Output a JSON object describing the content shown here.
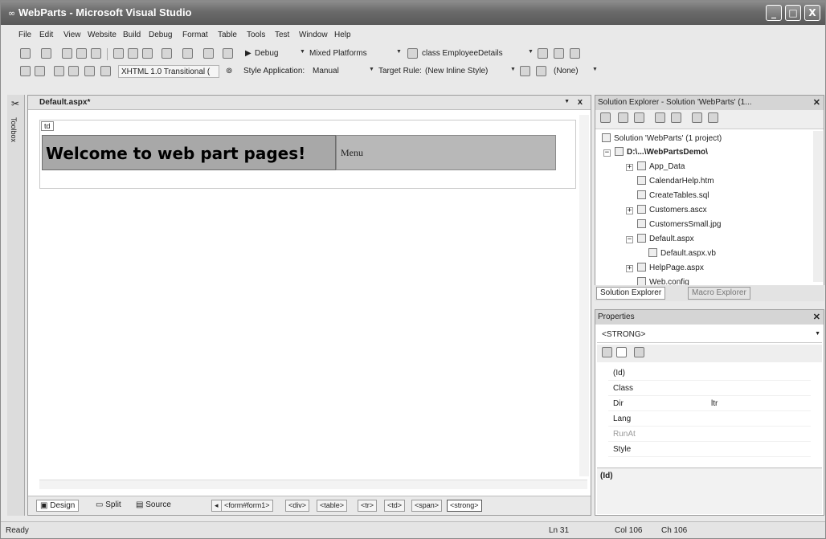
{
  "window": {
    "title": "WebParts - Microsoft Visual Studio",
    "buttons": {
      "minimize": "_",
      "maximize": "□",
      "close": "X"
    }
  },
  "menu": [
    "File",
    "Edit",
    "View",
    "Website",
    "Build",
    "Debug",
    "Format",
    "Table",
    "Tools",
    "Test",
    "Window",
    "Help"
  ],
  "toolbar1": {
    "config": "Debug",
    "platform": "Mixed Platforms",
    "find": "class EmployeeDetails"
  },
  "toolbar2": {
    "doctype": "XHTML 1.0 Transitional (",
    "style_application_label": "Style Application:",
    "style_application_value": "Manual",
    "target_rule_label": "Target Rule:",
    "target_rule_value": "(New Inline Style)",
    "style_value": "(None)"
  },
  "toolbox": {
    "label": "Toolbox"
  },
  "editor": {
    "tab": "Default.aspx*",
    "close": "x",
    "td_tag": "td",
    "welcome": "Welcome to web part pages!",
    "menu_cell": "Menu",
    "views": [
      "Design",
      "Split",
      "Source"
    ],
    "breadcrumbs": [
      "<form#form1>",
      "<div>",
      "<table>",
      "<tr>",
      "<td>",
      "<span>",
      "<strong>"
    ]
  },
  "solution_explorer": {
    "title": "Solution Explorer - Solution 'WebParts' (1...",
    "solution": "Solution 'WebParts' (1 project)",
    "project": "D:\\...\\WebPartsDemo\\",
    "items": [
      {
        "label": "App_Data",
        "expander": "+",
        "icon": "folder-icon"
      },
      {
        "label": "CalendarHelp.htm",
        "expander": "",
        "icon": "html-file-icon"
      },
      {
        "label": "CreateTables.sql",
        "expander": "",
        "icon": "sql-file-icon"
      },
      {
        "label": "Customers.ascx",
        "expander": "+",
        "icon": "ascx-file-icon"
      },
      {
        "label": "CustomersSmall.jpg",
        "expander": "",
        "icon": "image-file-icon"
      },
      {
        "label": "Default.aspx",
        "expander": "−",
        "icon": "aspx-file-icon"
      },
      {
        "label": "Default.aspx.vb",
        "expander": "",
        "icon": "vb-file-icon"
      },
      {
        "label": "HelpPage.aspx",
        "expander": "+",
        "icon": "aspx-file-icon"
      },
      {
        "label": "Web.config",
        "expander": "",
        "icon": "config-file-icon"
      }
    ],
    "tabs": [
      "Solution Explorer",
      "Macro Explorer"
    ]
  },
  "properties": {
    "title": "Properties",
    "selected": "<STRONG>",
    "rows": [
      {
        "name": "(Id)",
        "value": ""
      },
      {
        "name": "Class",
        "value": ""
      },
      {
        "name": "Dir",
        "value": "ltr"
      },
      {
        "name": "Lang",
        "value": ""
      },
      {
        "name": "RunAt",
        "value": ""
      },
      {
        "name": "Style",
        "value": ""
      }
    ],
    "description": "(Id)"
  },
  "status": {
    "left": "Ready",
    "ln": "Ln 31",
    "col": "Col 106",
    "ch": "Ch 106"
  }
}
